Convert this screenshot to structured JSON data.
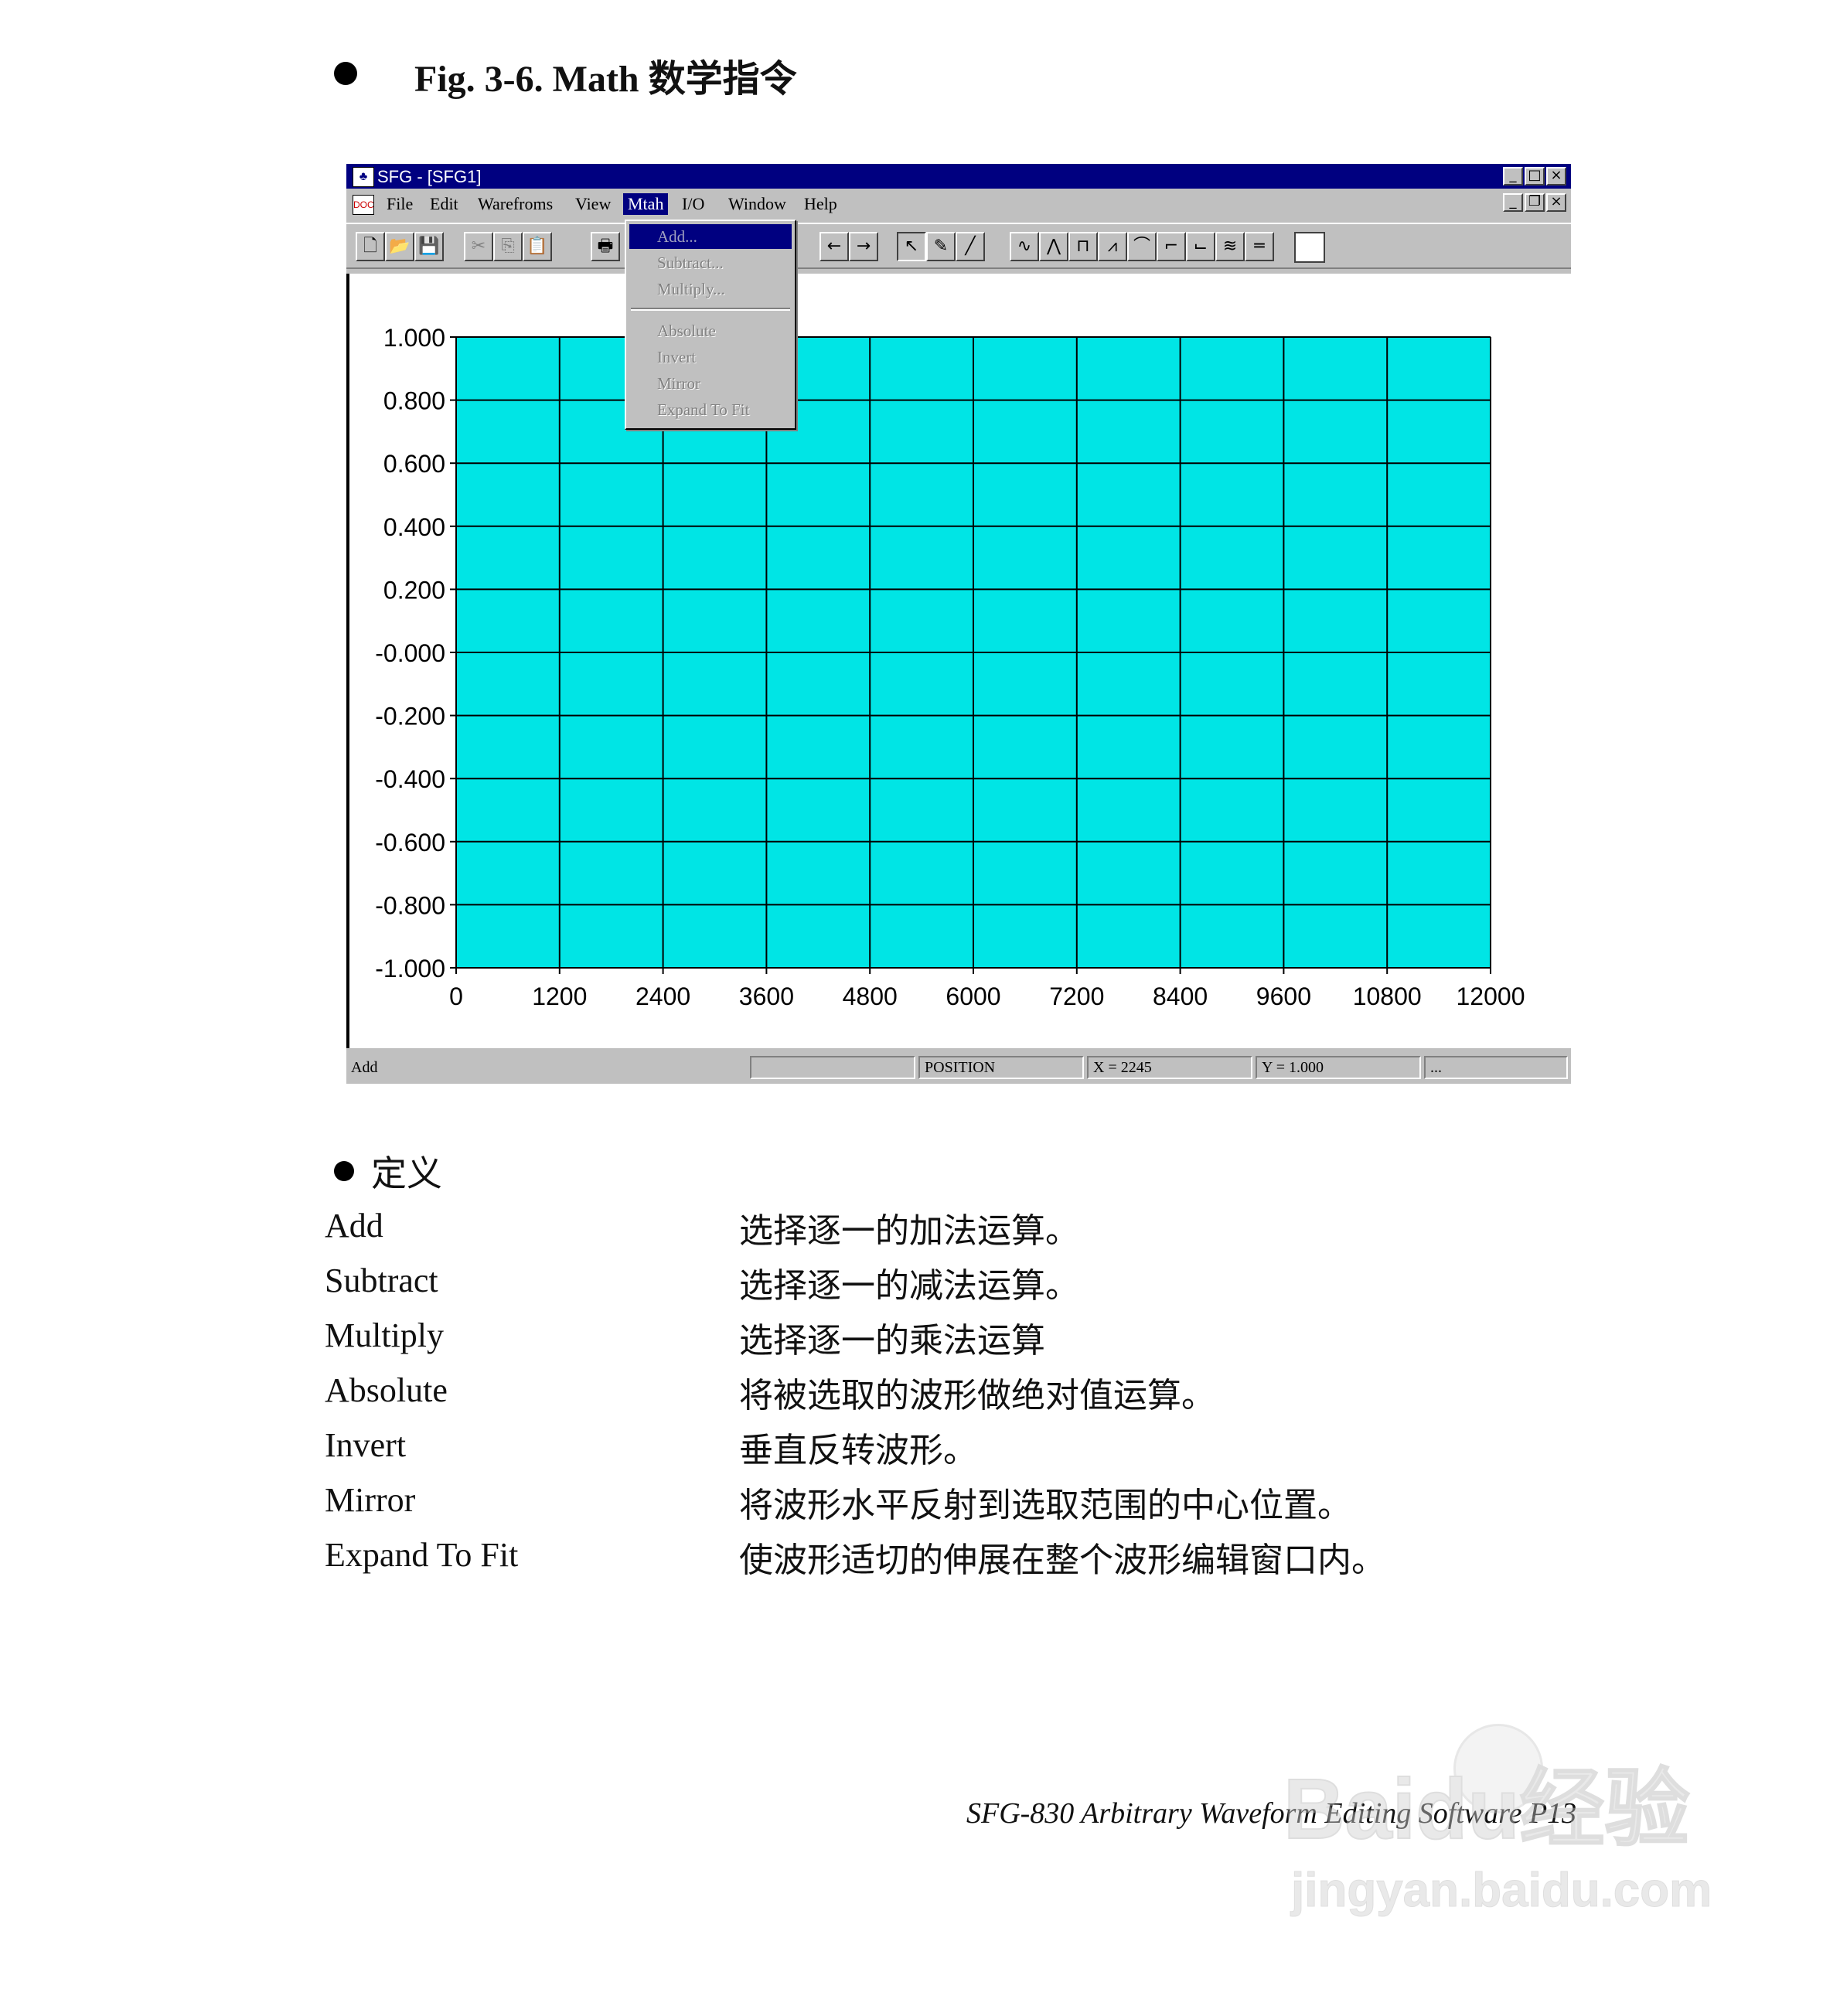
{
  "heading": {
    "text": "Fig. 3-6. Math 数学指令"
  },
  "window": {
    "title": "SFG - [SFG1]",
    "app_icon": "sfg-app-icon",
    "menu": [
      "File",
      "Edit",
      "Warefroms",
      "View",
      "Mtah",
      "I/O",
      "Window",
      "Help"
    ],
    "active_menu": "Mtah",
    "window_buttons": [
      "_",
      "□",
      "×"
    ],
    "doc_buttons": [
      "_",
      "❐",
      "×"
    ],
    "dropdown": {
      "group1": [
        "Add...",
        "Subtract...",
        "Multiply..."
      ],
      "group2": [
        "Absolute",
        "Invert",
        "Mirror",
        "Expand To Fit"
      ]
    },
    "toolbar_icons": [
      "new-icon",
      "open-icon",
      "save-icon",
      "cut-icon",
      "copy-icon",
      "paste-icon",
      "print-icon",
      "arrow-left-icon",
      "arrow-right-icon",
      "pointer-icon",
      "pencil-icon",
      "line-icon",
      "sine-icon",
      "triangle-icon",
      "square-icon",
      "sawtooth-icon",
      "sinc-icon",
      "exp-rise-icon",
      "exp-fall-icon",
      "noise-icon",
      "dc-icon",
      "color-swatch"
    ],
    "status": {
      "message": "Add",
      "position_label": "POSITION",
      "x_readout": "X = 2245",
      "y_readout": "Y = 1.000",
      "extra": "..."
    }
  },
  "chart_data": {
    "type": "area",
    "x": [
      0,
      12000
    ],
    "y": [
      1.0,
      1.0
    ],
    "fill_baseline": -1.0,
    "xlim": [
      0,
      12000
    ],
    "ylim": [
      -1.0,
      1.0
    ],
    "x_ticks": [
      "0",
      "1200",
      "2400",
      "3600",
      "4800",
      "6000",
      "7200",
      "8400",
      "9600",
      "10800",
      "12000"
    ],
    "y_ticks": [
      "1.000",
      "0.800",
      "0.600",
      "0.400",
      "0.200",
      "-0.000",
      "-0.200",
      "-0.400",
      "-0.600",
      "-0.800",
      "-1.000"
    ],
    "grid": true,
    "fill_color": "#00e5e5",
    "title": "",
    "xlabel": "",
    "ylabel": ""
  },
  "definitions": {
    "title": "定义",
    "items": [
      {
        "term": "Add",
        "desc": "选择逐一的加法运算。"
      },
      {
        "term": "Subtract",
        "desc": "选择逐一的减法运算。"
      },
      {
        "term": "Multiply",
        "desc": "选择逐一的乘法运算"
      },
      {
        "term": "Absolute",
        "desc": "将被选取的波形做绝对值运算。"
      },
      {
        "term": "Invert",
        "desc": "垂直反转波形。"
      },
      {
        "term": "Mirror",
        "desc": "将波形水平反射到选取范围的中心位置。"
      },
      {
        "term": "Expand To Fit",
        "desc": "使波形适切的伸展在整个波形编辑窗口内。"
      }
    ]
  },
  "footer": {
    "text": "SFG-830 Arbitrary Waveform Editing Software    P13"
  },
  "watermark": {
    "line1": "Baidu经验",
    "line2": "jingyan.baidu.com"
  }
}
